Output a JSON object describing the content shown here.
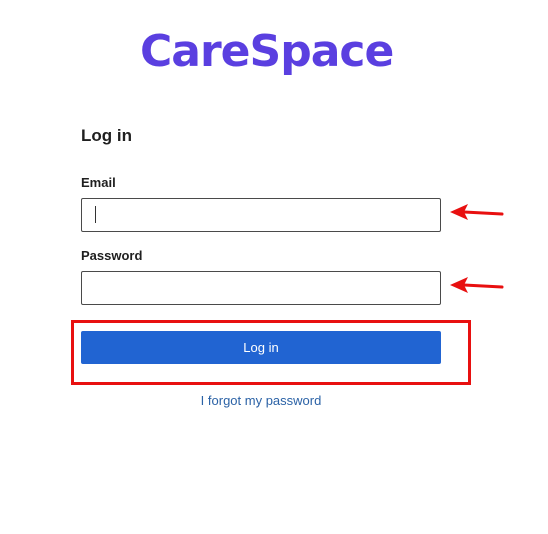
{
  "brand": {
    "name": "CareSpace",
    "color": "#5a3fe0"
  },
  "form": {
    "heading": "Log in",
    "email": {
      "label": "Email",
      "value": "",
      "placeholder": ""
    },
    "password": {
      "label": "Password",
      "value": "",
      "placeholder": ""
    },
    "submit_label": "Log in",
    "forgot_link": "I forgot my password"
  },
  "colors": {
    "primary_button": "#2164d2",
    "link": "#2b62a6",
    "annotation": "#e81010"
  },
  "annotations": {
    "email_arrow_icon": "left-arrow-icon",
    "password_arrow_icon": "left-arrow-icon",
    "login_highlight": "highlight-box"
  }
}
